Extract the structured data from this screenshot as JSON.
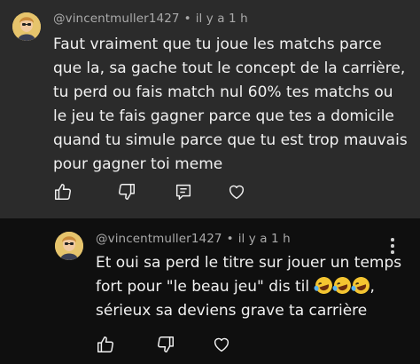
{
  "comments": [
    {
      "author": "@vincentmuller1427",
      "time": "il y a 1 h",
      "text": "Faut vraiment que tu joue les matchs parce\nque la, sa gache tout le concept de la carrière,\ntu perd ou fais match nul 60% tes matchs ou\nle jeu te fais gagner parce que tes a domicile\nquand tu simule parce que tu est trop mauvais\npour gagner toi meme"
    },
    {
      "author": "@vincentmuller1427",
      "time": "il y a 1 h",
      "text_line1": "Et oui sa perd le titre sur jouer un temps",
      "text_line2": "fort pour \"le beau jeu\" dis til",
      "text_line2_tail": ",",
      "text_line3": "sérieux sa deviens grave ta carrière",
      "emoji_name": "rolling-on-the-floor-laughing-emoji"
    }
  ],
  "icons": {
    "like": "thumbs-up-icon",
    "dislike": "thumbs-down-icon",
    "reply": "reply-icon",
    "heart": "heart-icon",
    "menu": "more-vertical-icon"
  },
  "colors": {
    "highlighted_comment_bg": "#2b2b2b",
    "page_bg": "#0f0f0f",
    "meta_text": "#aaaaaa"
  }
}
